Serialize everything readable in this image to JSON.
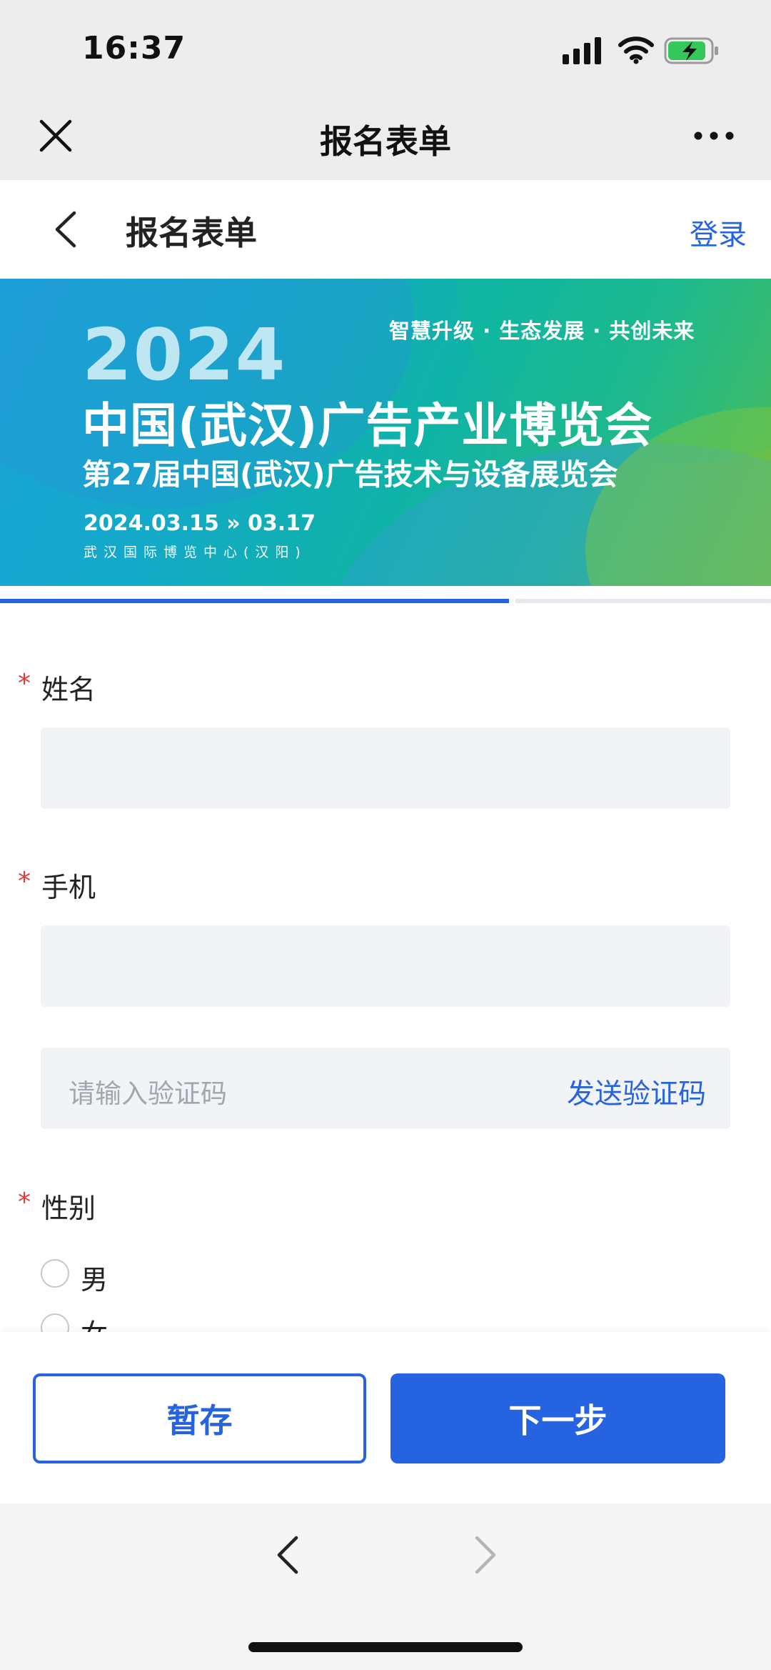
{
  "status": {
    "time": "16:37"
  },
  "wechat": {
    "title": "报名表单"
  },
  "header": {
    "title": "报名表单",
    "login": "登录"
  },
  "banner": {
    "year": "2024",
    "slogan": "智慧升级 · 生态发展 · 共创未来",
    "title": "中国(武汉)广告产业博览会",
    "subtitle": "第27届中国(武汉)广告技术与设备展览会",
    "dates": "2024.03.15 » 03.17",
    "venue": "武汉国际博览中心(汉阳)"
  },
  "progress": {
    "fraction": 0.66
  },
  "form": {
    "required_mark": "*",
    "name": {
      "label": "姓名",
      "value": ""
    },
    "phone": {
      "label": "手机",
      "value": ""
    },
    "code": {
      "placeholder": "请输入验证码",
      "send_label": "发送验证码"
    },
    "gender": {
      "label": "性别",
      "options": [
        "男",
        "女"
      ]
    }
  },
  "buttons": {
    "save": "暂存",
    "next": "下一步"
  },
  "colors": {
    "accent": "#2563e0",
    "required": "#e53935"
  }
}
